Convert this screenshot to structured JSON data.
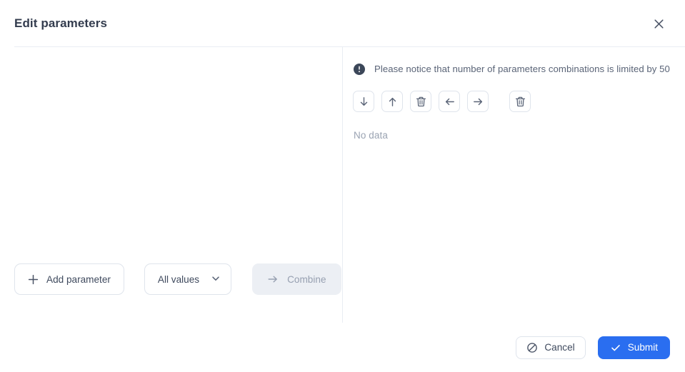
{
  "dialog": {
    "title": "Edit parameters",
    "close_icon": "close-icon"
  },
  "right_panel": {
    "notice": {
      "icon": "exclamation-circle-icon",
      "text": "Please notice that number of parameters combinations is limited by 50"
    },
    "toolbar": [
      {
        "name": "move-down-button",
        "icon": "arrow-down-icon"
      },
      {
        "name": "move-up-button",
        "icon": "arrow-up-icon"
      },
      {
        "name": "delete-row-button",
        "icon": "trash-icon"
      },
      {
        "name": "move-left-button",
        "icon": "arrow-left-icon"
      },
      {
        "name": "move-right-button",
        "icon": "arrow-right-icon"
      },
      {
        "name": "delete-column-button",
        "icon": "trash-icon"
      }
    ],
    "empty_text": "No data"
  },
  "left_panel": {
    "add_parameter": {
      "label": "Add parameter",
      "icon": "plus-icon"
    },
    "values_select": {
      "value": "All values",
      "icon": "chevron-down-icon",
      "options": [
        "All values"
      ]
    },
    "combine": {
      "label": "Combine",
      "icon": "arrow-right-icon",
      "disabled": true
    }
  },
  "footer": {
    "cancel": {
      "label": "Cancel",
      "icon": "ban-icon"
    },
    "submit": {
      "label": "Submit",
      "icon": "check-icon"
    }
  },
  "colors": {
    "accent": "#2a6ef0",
    "title": "#333c4e",
    "text": "#3f4a5e",
    "muted": "#9aa3b2",
    "border": "#dfe4ec",
    "divider": "#e9edf3",
    "disabled_bg": "#eceff4",
    "notice_icon_bg": "#3c4759"
  }
}
